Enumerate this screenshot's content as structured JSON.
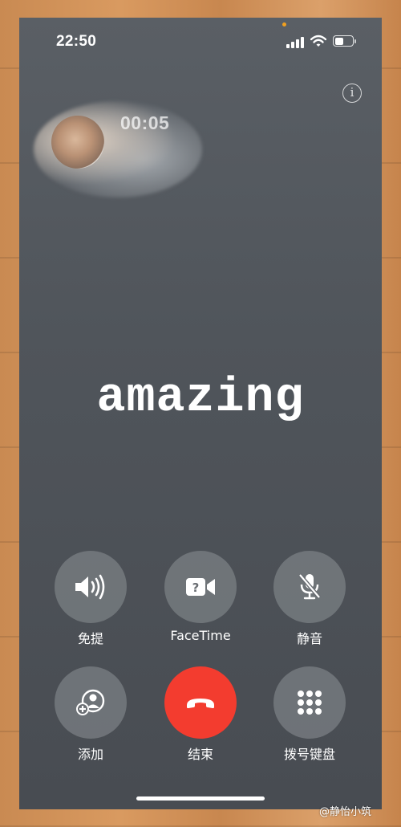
{
  "status_bar": {
    "time": "22:50",
    "battery_level": 0.55,
    "signal_bars": 4
  },
  "call": {
    "duration": "00:05",
    "caller_name": "amazing"
  },
  "controls": {
    "speaker": {
      "label": "免提",
      "icon": "speaker-icon"
    },
    "facetime": {
      "label": "FaceTime",
      "icon": "facetime-video-icon"
    },
    "mute": {
      "label": "静音",
      "icon": "mic-off-icon"
    },
    "add_call": {
      "label": "添加",
      "icon": "add-person-icon"
    },
    "end_call": {
      "label": "结束",
      "icon": "phone-hangup-icon"
    },
    "keypad": {
      "label": "拨号键盘",
      "icon": "keypad-icon"
    }
  },
  "colors": {
    "end_call": "#f33c2f",
    "control_bg": "#7a7e83",
    "screen_bg": "#52575d",
    "indicator_dot": "#f0a020"
  },
  "watermark": "@静怡小筑"
}
